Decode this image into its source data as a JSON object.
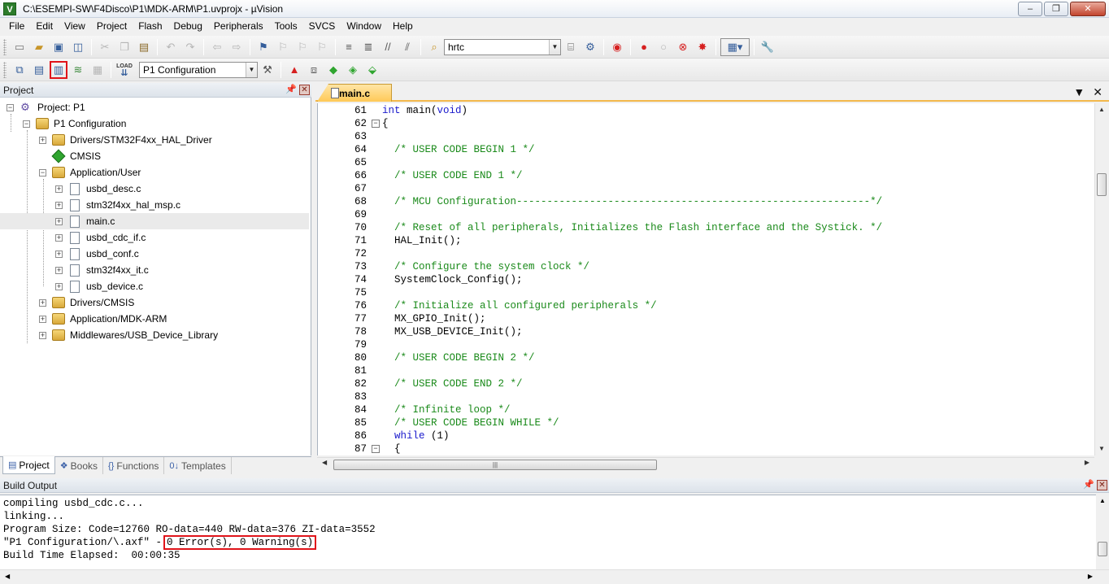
{
  "window": {
    "title": "C:\\ESEMPI-SW\\F4Disco\\P1\\MDK-ARM\\P1.uvprojx - µVision",
    "app_icon": "V",
    "controls": {
      "minimize": "‒",
      "restore": "❐",
      "close": "✕"
    }
  },
  "menu": [
    "File",
    "Edit",
    "View",
    "Project",
    "Flash",
    "Debug",
    "Peripherals",
    "Tools",
    "SVCS",
    "Window",
    "Help"
  ],
  "toolbar1": {
    "find_value": "hrtc"
  },
  "toolbar2": {
    "target_value": "P1 Configuration",
    "load_label": "LOAD"
  },
  "project_pane": {
    "title": "Project",
    "tree": [
      {
        "label": "Project: P1",
        "level": 0,
        "icon": "project-icon",
        "expander": "−"
      },
      {
        "label": "P1 Configuration",
        "level": 1,
        "icon": "folder-icon",
        "expander": "−"
      },
      {
        "label": "Drivers/STM32F4xx_HAL_Driver",
        "level": 2,
        "icon": "folder-icon",
        "expander": "+"
      },
      {
        "label": "CMSIS",
        "level": 2,
        "icon": "gem-icon",
        "expander": ""
      },
      {
        "label": "Application/User",
        "level": 2,
        "icon": "folder-icon",
        "expander": "−"
      },
      {
        "label": "usbd_desc.c",
        "level": 3,
        "icon": "file-icon",
        "expander": "+"
      },
      {
        "label": "stm32f4xx_hal_msp.c",
        "level": 3,
        "icon": "file-icon",
        "expander": "+"
      },
      {
        "label": "main.c",
        "level": 3,
        "icon": "file-icon",
        "expander": "+",
        "selected": true
      },
      {
        "label": "usbd_cdc_if.c",
        "level": 3,
        "icon": "file-icon",
        "expander": "+"
      },
      {
        "label": "usbd_conf.c",
        "level": 3,
        "icon": "file-icon",
        "expander": "+"
      },
      {
        "label": "stm32f4xx_it.c",
        "level": 3,
        "icon": "file-icon",
        "expander": "+"
      },
      {
        "label": "usb_device.c",
        "level": 3,
        "icon": "file-icon",
        "expander": "+"
      },
      {
        "label": "Drivers/CMSIS",
        "level": 2,
        "icon": "folder-icon",
        "expander": "+"
      },
      {
        "label": "Application/MDK-ARM",
        "level": 2,
        "icon": "folder-icon",
        "expander": "+"
      },
      {
        "label": "Middlewares/USB_Device_Library",
        "level": 2,
        "icon": "folder-icon",
        "expander": "+"
      }
    ],
    "tabs": [
      {
        "label": "Project",
        "icon": "▤",
        "active": true
      },
      {
        "label": "Books",
        "icon": "❖",
        "active": false
      },
      {
        "label": "Functions",
        "icon": "{}",
        "active": false
      },
      {
        "label": "Templates",
        "icon": "0↓",
        "active": false
      }
    ]
  },
  "editor": {
    "tab_label": "main.c",
    "lines": [
      {
        "n": "61",
        "fold": "",
        "segs": [
          [
            "kw",
            "int"
          ],
          [
            "pl",
            " main("
          ],
          [
            "kw",
            "void"
          ],
          [
            "pl",
            ")"
          ]
        ]
      },
      {
        "n": "62",
        "fold": "−",
        "segs": [
          [
            "pl",
            "{"
          ]
        ]
      },
      {
        "n": "63",
        "fold": "",
        "segs": []
      },
      {
        "n": "64",
        "fold": "",
        "segs": [
          [
            "pl",
            "  "
          ],
          [
            "cm",
            "/* USER CODE BEGIN 1 */"
          ]
        ]
      },
      {
        "n": "65",
        "fold": "",
        "segs": []
      },
      {
        "n": "66",
        "fold": "",
        "segs": [
          [
            "pl",
            "  "
          ],
          [
            "cm",
            "/* USER CODE END 1 */"
          ]
        ]
      },
      {
        "n": "67",
        "fold": "",
        "segs": []
      },
      {
        "n": "68",
        "fold": "",
        "segs": [
          [
            "pl",
            "  "
          ],
          [
            "cm",
            "/* MCU Configuration----------------------------------------------------------*/"
          ]
        ]
      },
      {
        "n": "69",
        "fold": "",
        "segs": []
      },
      {
        "n": "70",
        "fold": "",
        "segs": [
          [
            "pl",
            "  "
          ],
          [
            "cm",
            "/* Reset of all peripherals, Initializes the Flash interface and the Systick. */"
          ]
        ]
      },
      {
        "n": "71",
        "fold": "",
        "segs": [
          [
            "pl",
            "  HAL_Init();"
          ]
        ]
      },
      {
        "n": "72",
        "fold": "",
        "segs": []
      },
      {
        "n": "73",
        "fold": "",
        "segs": [
          [
            "pl",
            "  "
          ],
          [
            "cm",
            "/* Configure the system clock */"
          ]
        ]
      },
      {
        "n": "74",
        "fold": "",
        "segs": [
          [
            "pl",
            "  SystemClock_Config();"
          ]
        ]
      },
      {
        "n": "75",
        "fold": "",
        "segs": []
      },
      {
        "n": "76",
        "fold": "",
        "segs": [
          [
            "pl",
            "  "
          ],
          [
            "cm",
            "/* Initialize all configured peripherals */"
          ]
        ]
      },
      {
        "n": "77",
        "fold": "",
        "segs": [
          [
            "pl",
            "  MX_GPIO_Init();"
          ]
        ]
      },
      {
        "n": "78",
        "fold": "",
        "segs": [
          [
            "pl",
            "  MX_USB_DEVICE_Init();"
          ]
        ]
      },
      {
        "n": "79",
        "fold": "",
        "segs": []
      },
      {
        "n": "80",
        "fold": "",
        "segs": [
          [
            "pl",
            "  "
          ],
          [
            "cm",
            "/* USER CODE BEGIN 2 */"
          ]
        ]
      },
      {
        "n": "81",
        "fold": "",
        "segs": []
      },
      {
        "n": "82",
        "fold": "",
        "segs": [
          [
            "pl",
            "  "
          ],
          [
            "cm",
            "/* USER CODE END 2 */"
          ]
        ]
      },
      {
        "n": "83",
        "fold": "",
        "segs": []
      },
      {
        "n": "84",
        "fold": "",
        "segs": [
          [
            "pl",
            "  "
          ],
          [
            "cm",
            "/* Infinite loop */"
          ]
        ]
      },
      {
        "n": "85",
        "fold": "",
        "segs": [
          [
            "pl",
            "  "
          ],
          [
            "cm",
            "/* USER CODE BEGIN WHILE */"
          ]
        ]
      },
      {
        "n": "86",
        "fold": "",
        "segs": [
          [
            "pl",
            "  "
          ],
          [
            "kw",
            "while"
          ],
          [
            "pl",
            " (1)"
          ]
        ]
      },
      {
        "n": "87",
        "fold": "−",
        "segs": [
          [
            "pl",
            "  {"
          ]
        ]
      }
    ]
  },
  "build_output": {
    "title": "Build Output",
    "lines": [
      "compiling usbd_cdc.c...",
      "linking...",
      "Program Size: Code=12760 RO-data=440 RW-data=376 ZI-data=3552",
      "\"P1 Configuration/\\.axf\" -",
      "Build Time Elapsed:  00:00:35"
    ],
    "result": "0 Error(s), 0 Warning(s)"
  },
  "colors": {
    "keyword": "#1a1acc",
    "comment": "#1a8a1a",
    "highlight_box": "#e0141a",
    "active_tab": "#ffc957"
  }
}
